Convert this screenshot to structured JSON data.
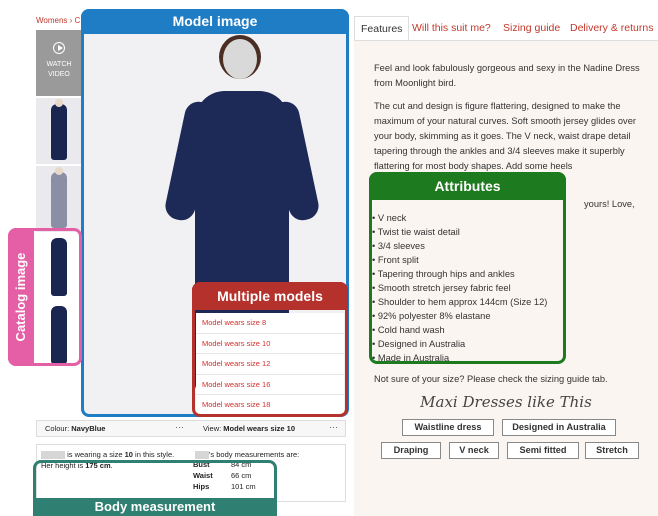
{
  "breadcrumb": "Womens › C",
  "video_label": "WATCH VIDEO",
  "annotations": {
    "model_image": "Model image",
    "catalog_image": "Catalog image",
    "multiple_models": "Multiple models",
    "attributes": "Attributes",
    "body_measurement": "Body measurement"
  },
  "models": [
    "Model wears size 8",
    "Model wears size 10",
    "Model wears size 12",
    "Model wears size 16",
    "Model wears size 18"
  ],
  "colour": {
    "label": "Colour: ",
    "value": "NavyBlue"
  },
  "view": {
    "label": "View: ",
    "value": "Model wears size 10"
  },
  "measurement": {
    "line1_pre": "is wearing a size ",
    "line1_size": "10",
    "line1_post": " in this style.",
    "line1_right": "'s body measurements are:",
    "height_pre": "Her height is ",
    "height_value": "175 cm",
    "height_post": ".",
    "rows": [
      {
        "label": "Bust",
        "value": "84 cm"
      },
      {
        "label": "Waist",
        "value": "66 cm"
      },
      {
        "label": "Hips",
        "value": "101 cm"
      }
    ]
  },
  "tabs": [
    "Features",
    "Will this suit me?",
    "Sizing guide",
    "Delivery & returns"
  ],
  "description": [
    "Feel and look fabulously gorgeous and sexy in the Nadine Dress from Moonlight bird.",
    "The cut and design is figure flattering, designed to make the maximum of your natural curves. Soft smooth jersey glides over your body, skimming as it goes. The V neck, waist drape detail tapering through the ankles and 3/4 sleeves make it superbly flattering for most body shapes. Add some heels"
  ],
  "desc_tail": "yours! Love,",
  "attributes": [
    "V neck",
    "Twist tie waist detail",
    "3/4 sleeves",
    "Front split",
    "Tapering through hips and ankles",
    "Smooth stretch jersey fabric feel",
    "Shoulder to hem approx 144cm (Size 12)",
    "92% polyester 8% elastane",
    "Cold hand wash",
    "Designed in Australia",
    "Made in Australia"
  ],
  "size_note": "Not sure of your size? Please check the sizing guide tab.",
  "maxi_heading": "Maxi Dresses like This",
  "chips": [
    "Waistline dress",
    "Designed in Australia",
    "Draping",
    "V neck",
    "Semi fitted",
    "Stretch"
  ],
  "colors": {
    "model_blue": "#1f7dc6",
    "catalog_pink": "#e45fa6",
    "models_red": "#b5312c",
    "attr_green": "#1e7a1e",
    "body_teal": "#2f7f72"
  }
}
